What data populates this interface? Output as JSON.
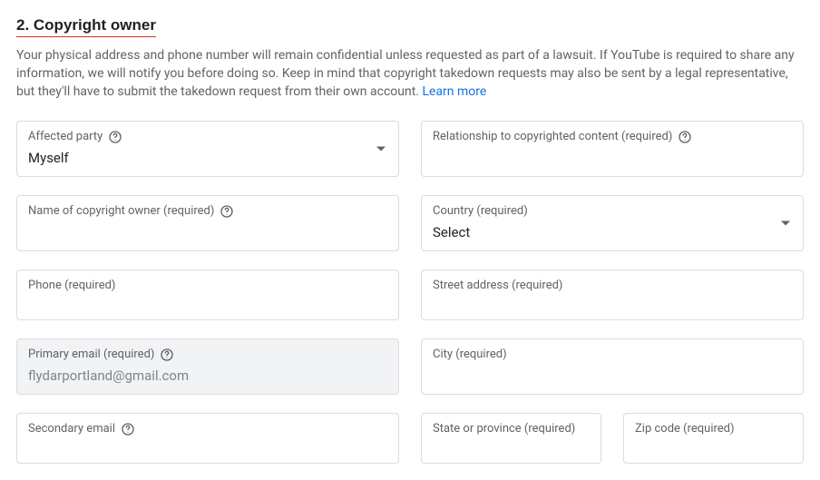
{
  "section": {
    "heading": "2. Copyright owner",
    "description_prefix": "Your physical address and phone number will remain confidential unless requested as part of a lawsuit. If YouTube is required to share any information, we will notify you before doing so. Keep in mind that copyright takedown requests may also be sent by a legal representative, but they'll have to submit the takedown request from their own account. ",
    "learn_more": "Learn more"
  },
  "fields": {
    "affected_party": {
      "label": "Affected party",
      "value": "Myself"
    },
    "relationship": {
      "label": "Relationship to copyrighted content (required)"
    },
    "copyright_owner_name": {
      "label": "Name of copyright owner (required)"
    },
    "country": {
      "label": "Country (required)",
      "value": "Select"
    },
    "phone": {
      "label": "Phone (required)"
    },
    "street_address": {
      "label": "Street address (required)"
    },
    "primary_email": {
      "label": "Primary email (required)",
      "value": "flydarportland@gmail.com"
    },
    "city": {
      "label": "City (required)"
    },
    "secondary_email": {
      "label": "Secondary email"
    },
    "state": {
      "label": "State or province (required)"
    },
    "zip": {
      "label": "Zip code (required)"
    }
  }
}
